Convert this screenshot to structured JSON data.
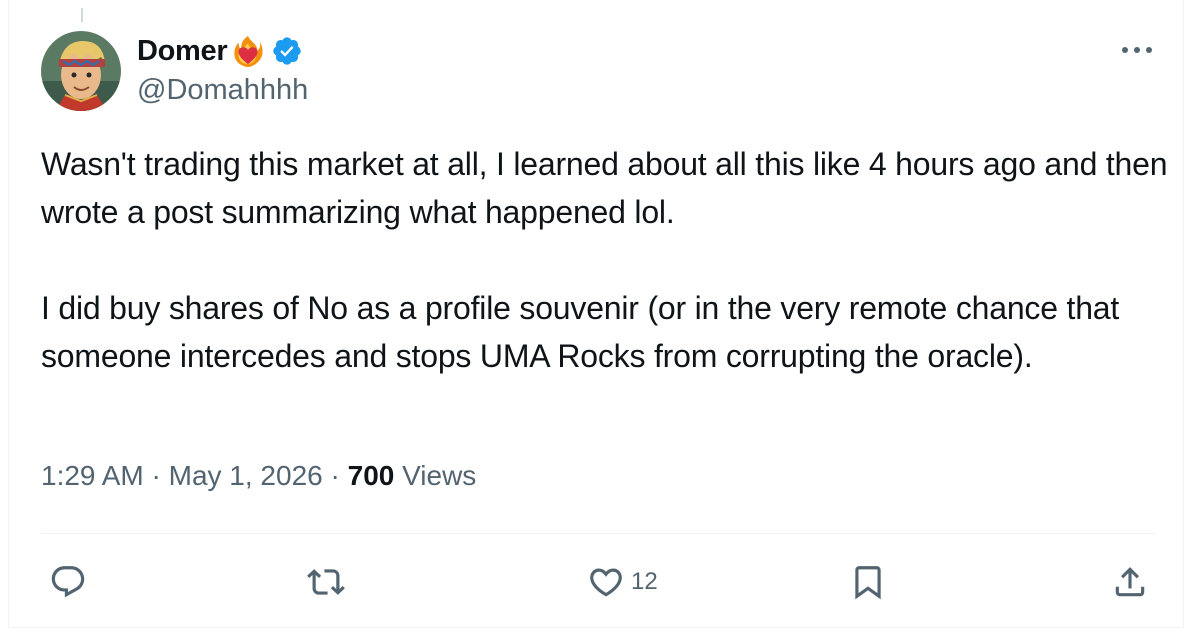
{
  "author": {
    "display_name": "Domer",
    "handle": "@Domahhhh",
    "emoji": "heart-on-fire",
    "verified": true,
    "verified_color": "#1d9bf0"
  },
  "tweet": {
    "paragraphs": [
      "Wasn't trading this market at all, I learned about all this like 4 hours ago and then wrote a post summarizing what happened lol.",
      "I did buy shares of No as a profile souvenir (or in the very remote chance that someone intercedes and stops UMA Rocks from corrupting the oracle)."
    ],
    "time": "1:29 AM",
    "separator": " · ",
    "date": "May 1, 2026",
    "views_count": "700",
    "views_label": " Views"
  },
  "actions": {
    "reply_icon": "reply-icon",
    "retweet_icon": "retweet-icon",
    "like_icon": "heart-icon",
    "like_count": "12",
    "bookmark_icon": "bookmark-icon",
    "share_icon": "share-icon"
  },
  "colors": {
    "text_primary": "#0f1419",
    "text_secondary": "#536471",
    "divider": "#eff3f4"
  }
}
